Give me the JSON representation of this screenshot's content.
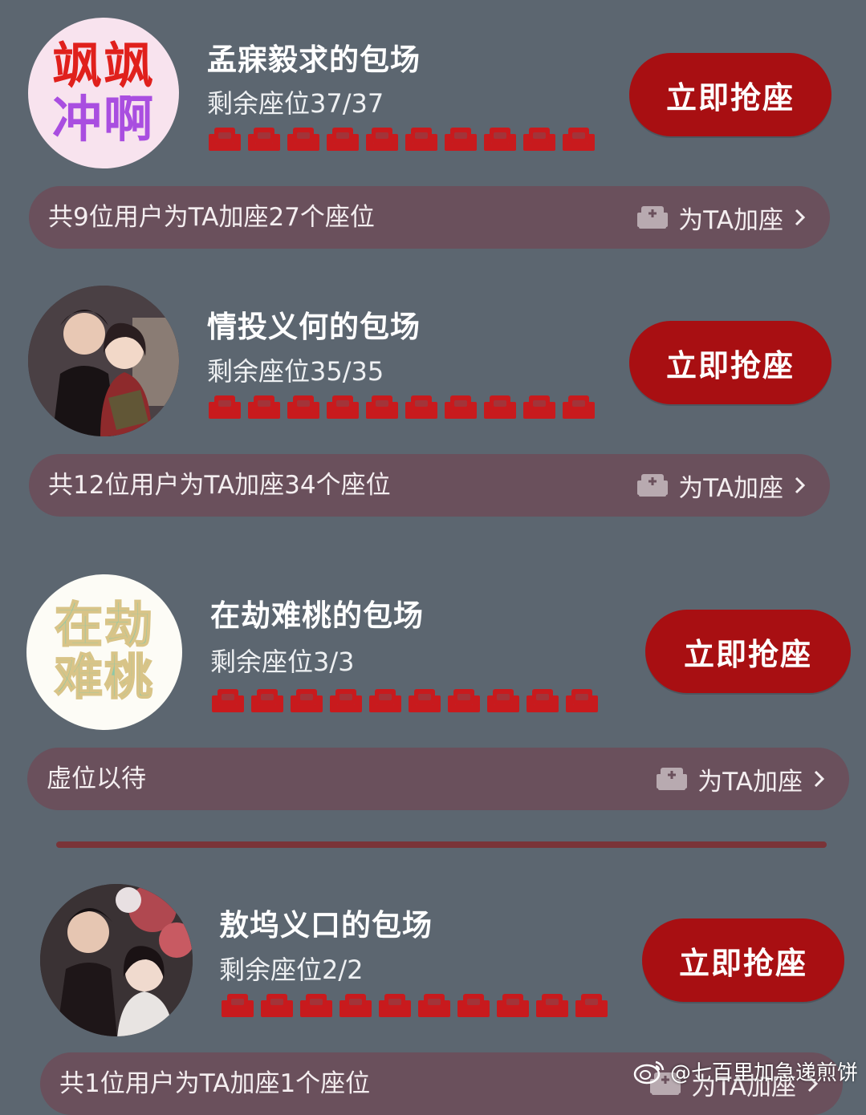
{
  "colors": {
    "background": "#5c6670",
    "accent_red": "#a80f12",
    "seat_red": "#c81a1d",
    "bar_bg": "#6a505c"
  },
  "items": [
    {
      "avatar_line1": "飒飒",
      "avatar_line2": "冲啊",
      "title": "孟寐毅求的包场",
      "remaining": "剩余座位37/37",
      "button_label": "立即抢座",
      "summary": "共9位用户为TA加座27个座位",
      "action_label": "为TA加座",
      "filled_seats": 10
    },
    {
      "avatar_image": "couple-photo",
      "title": "情投义何的包场",
      "remaining": "剩余座位35/35",
      "button_label": "立即抢座",
      "summary": "共12位用户为TA加座34个座位",
      "action_label": "为TA加座",
      "filled_seats": 10
    },
    {
      "avatar_line1": "在劫",
      "avatar_line2": "难桃",
      "title": "在劫难桃的包场",
      "remaining": "剩余座位3/3",
      "button_label": "立即抢座",
      "summary": "虚位以待",
      "action_label": "为TA加座",
      "filled_seats": 10
    },
    {
      "avatar_image": "couple-drama-photo",
      "title": "敖坞义口的包场",
      "remaining": "剩余座位2/2",
      "button_label": "立即抢座",
      "summary": "共1位用户为TA加座1个座位",
      "action_label": "为TA加座",
      "filled_seats": 10
    }
  ],
  "watermark": "@七百里加急递煎饼"
}
